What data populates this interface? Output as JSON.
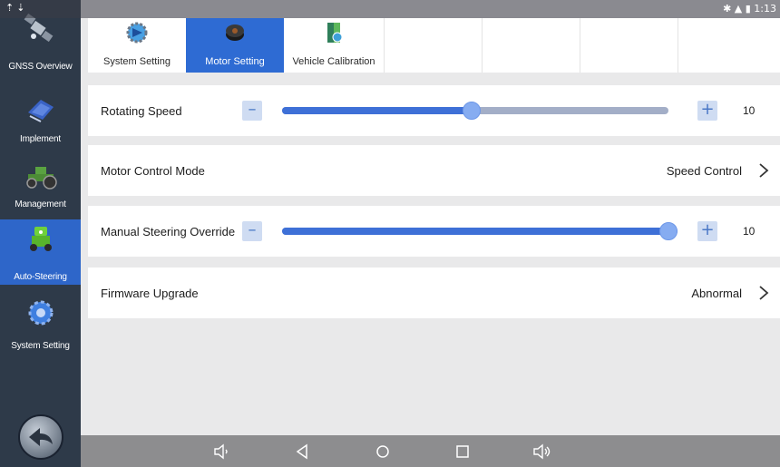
{
  "statusbar": {
    "left_icons": "⇡ ⇣",
    "right_text": "1:13"
  },
  "sidebar": {
    "items": [
      {
        "label": "GNSS Overview",
        "icon": "satellite-icon"
      },
      {
        "label": "Implement",
        "icon": "implement-icon"
      },
      {
        "label": "Management",
        "icon": "tractor-icon"
      },
      {
        "label": "Auto-Steering",
        "icon": "auto-steering-icon"
      },
      {
        "label": "System Setting",
        "icon": "gear-icon"
      }
    ],
    "back_icon": "back-arrow-icon"
  },
  "tabs": [
    {
      "label": "System Setting",
      "icon": "system-setting-icon"
    },
    {
      "label": "Motor Setting",
      "icon": "motor-icon"
    },
    {
      "label": "Vehicle Calibration",
      "icon": "vehicle-calibration-icon"
    }
  ],
  "rows": {
    "rotating_speed": {
      "label": "Rotating Speed",
      "value": "10",
      "level": 0.49
    },
    "motor_control_mode": {
      "label": "Motor Control Mode",
      "value": "Speed Control"
    },
    "manual_steering_override": {
      "label": "Manual Steering Override",
      "value": "10",
      "level": 1.0
    },
    "firmware_upgrade": {
      "label": "Firmware Upgrade",
      "value": "Abnormal"
    }
  },
  "controls": {
    "minus": "–",
    "plus": "+"
  },
  "colors": {
    "accent": "#2e6bd3",
    "sidebar": "#2e3a49",
    "fill": "#3e70d7",
    "track": "#a3aec7"
  }
}
